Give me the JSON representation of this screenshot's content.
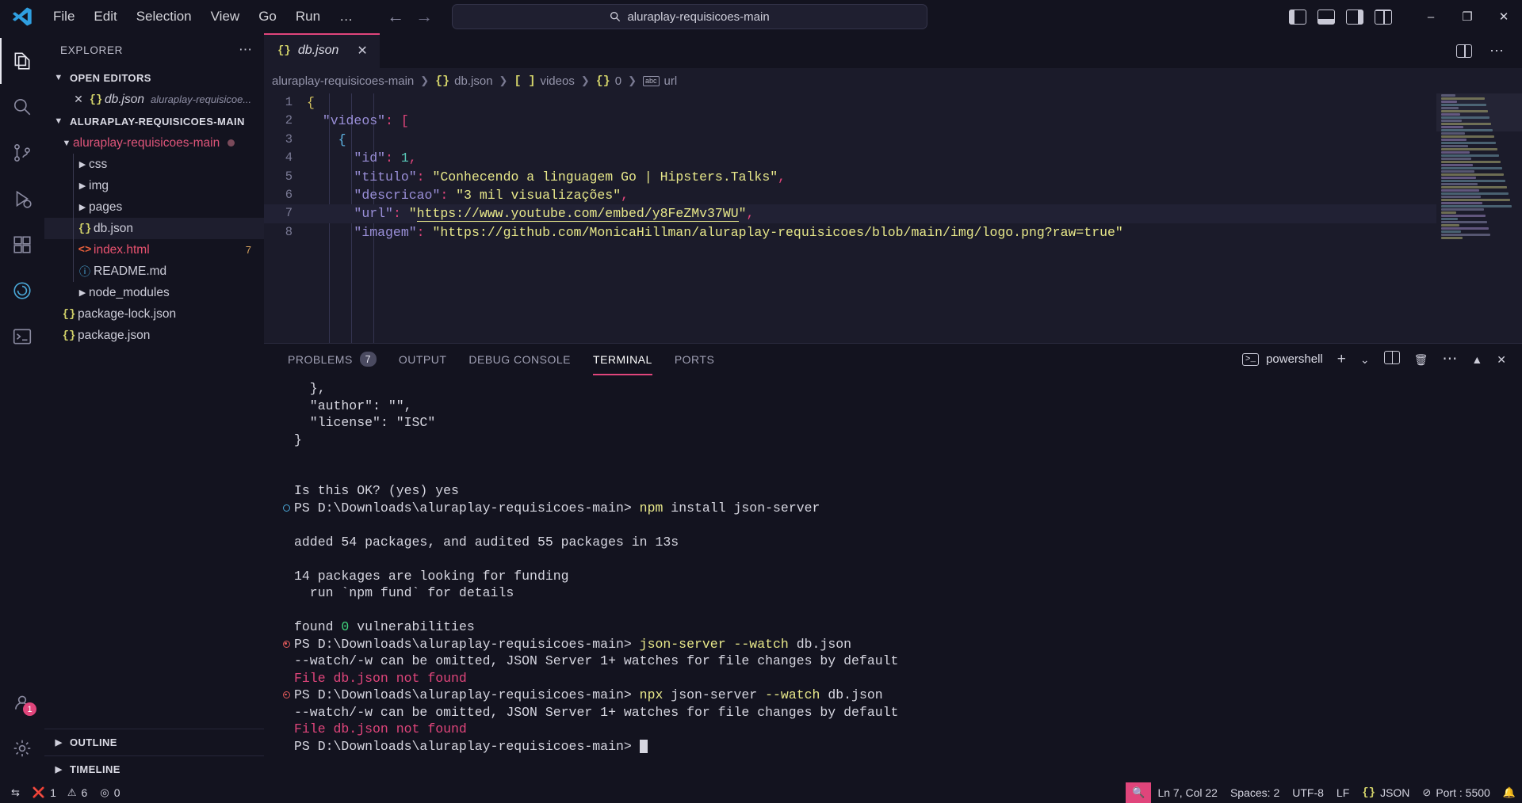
{
  "titlebar": {
    "logo_icon": "vscode-logo-icon",
    "menu": [
      "File",
      "Edit",
      "Selection",
      "View",
      "Go",
      "Run",
      "…"
    ],
    "back_icon": "arrow-left-icon",
    "forward_icon": "arrow-right-icon",
    "search": {
      "value": "aluraplay-requisicoes-main",
      "icon": "search-icon"
    },
    "layout_icons": [
      "toggle-primary-sidebar-icon",
      "toggle-panel-icon",
      "toggle-secondary-sidebar-icon",
      "customize-layout-icon"
    ],
    "window_buttons": {
      "minimize": "–",
      "maximize": "❐",
      "close": "✕"
    }
  },
  "activitybar": {
    "items": [
      {
        "name": "explorer",
        "icon": "files-icon",
        "active": true
      },
      {
        "name": "search",
        "icon": "search-icon",
        "active": false
      },
      {
        "name": "source-control",
        "icon": "source-control-icon",
        "active": false
      },
      {
        "name": "run-and-debug",
        "icon": "debug-icon",
        "active": false
      },
      {
        "name": "extensions",
        "icon": "extensions-icon",
        "active": false
      },
      {
        "name": "live-share",
        "icon": "live-share-icon",
        "active": false
      },
      {
        "name": "terminal-view",
        "icon": "terminal-icon",
        "active": false
      }
    ],
    "accounts": {
      "icon": "account-icon",
      "badge": "1"
    },
    "settings": {
      "icon": "gear-icon"
    }
  },
  "sidebar": {
    "title": "EXPLORER",
    "more_icon": "more-actions-icon",
    "open_editors": {
      "label": "OPEN EDITORS",
      "items": [
        {
          "close_icon": "close-icon",
          "file_icon": "json-icon",
          "name": "db.json",
          "path": "aluraplay-requisicoe..."
        }
      ]
    },
    "workspace": {
      "label": "ALURAPLAY-REQUISICOES-MAIN",
      "tree": [
        {
          "type": "folder",
          "name": "aluraplay-requisicoes-main",
          "expanded": true,
          "depth": 0,
          "dirty": true
        },
        {
          "type": "folder",
          "name": "css",
          "expanded": false,
          "depth": 1
        },
        {
          "type": "folder",
          "name": "img",
          "expanded": false,
          "depth": 1
        },
        {
          "type": "folder",
          "name": "pages",
          "expanded": false,
          "depth": 1
        },
        {
          "type": "file",
          "name": "db.json",
          "icon": "json-icon",
          "depth": 1,
          "selected": true
        },
        {
          "type": "file",
          "name": "index.html",
          "icon": "html-icon",
          "depth": 1,
          "problems": "7"
        },
        {
          "type": "file",
          "name": "README.md",
          "icon": "markdown-icon",
          "depth": 1
        },
        {
          "type": "folder",
          "name": "node_modules",
          "expanded": false,
          "depth": 1
        },
        {
          "type": "file",
          "name": "package-lock.json",
          "icon": "json-icon",
          "depth": 0
        },
        {
          "type": "file",
          "name": "package.json",
          "icon": "json-icon",
          "depth": 0
        }
      ]
    },
    "outline": "OUTLINE",
    "timeline": "TIMELINE"
  },
  "editor": {
    "tab": {
      "icon": "json-icon",
      "name": "db.json",
      "close_icon": "close-icon"
    },
    "tab_actions": [
      "split-editor-icon",
      "more-actions-icon"
    ],
    "breadcrumb": [
      {
        "text": "aluraplay-requisicoes-main",
        "icon": ""
      },
      {
        "text": "db.json",
        "icon": "json-icon"
      },
      {
        "text": "videos",
        "icon": "array-icon"
      },
      {
        "text": "0",
        "icon": "object-icon"
      },
      {
        "text": "url",
        "icon": "string-icon"
      }
    ],
    "lines": [
      {
        "n": "1",
        "segs": [
          {
            "t": "{",
            "c": "t-brace1"
          }
        ]
      },
      {
        "n": "2",
        "segs": [
          {
            "t": "  ",
            "c": "t-punc"
          },
          {
            "t": "\"videos\"",
            "c": "t-key"
          },
          {
            "t": ":",
            "c": "t-colon"
          },
          {
            "t": " ",
            "c": "t-punc"
          },
          {
            "t": "[",
            "c": "t-brace3"
          }
        ]
      },
      {
        "n": "3",
        "segs": [
          {
            "t": "    ",
            "c": "t-punc"
          },
          {
            "t": "{",
            "c": "t-brace2"
          }
        ]
      },
      {
        "n": "4",
        "segs": [
          {
            "t": "      ",
            "c": "t-punc"
          },
          {
            "t": "\"id\"",
            "c": "t-key"
          },
          {
            "t": ":",
            "c": "t-colon"
          },
          {
            "t": " ",
            "c": "t-punc"
          },
          {
            "t": "1",
            "c": "t-num"
          },
          {
            "t": ",",
            "c": "t-colon"
          }
        ]
      },
      {
        "n": "5",
        "segs": [
          {
            "t": "      ",
            "c": "t-punc"
          },
          {
            "t": "\"titulo\"",
            "c": "t-key"
          },
          {
            "t": ":",
            "c": "t-colon"
          },
          {
            "t": " ",
            "c": "t-punc"
          },
          {
            "t": "\"Conhecendo a linguagem Go | Hipsters.Talks\"",
            "c": "t-str"
          },
          {
            "t": ",",
            "c": "t-colon"
          }
        ]
      },
      {
        "n": "6",
        "segs": [
          {
            "t": "      ",
            "c": "t-punc"
          },
          {
            "t": "\"descricao\"",
            "c": "t-key"
          },
          {
            "t": ":",
            "c": "t-colon"
          },
          {
            "t": " ",
            "c": "t-punc"
          },
          {
            "t": "\"3 mil visualizações\"",
            "c": "t-str"
          },
          {
            "t": ",",
            "c": "t-colon"
          }
        ]
      },
      {
        "n": "7",
        "cur": true,
        "segs": [
          {
            "t": "      ",
            "c": "t-punc"
          },
          {
            "t": "\"url\"",
            "c": "t-key"
          },
          {
            "t": ":",
            "c": "t-colon"
          },
          {
            "t": " ",
            "c": "t-punc"
          },
          {
            "t": "\"",
            "c": "t-str"
          },
          {
            "t": "https://www.youtube.com/embed/y8FeZMv37WU",
            "c": "t-link"
          },
          {
            "t": "\"",
            "c": "t-str"
          },
          {
            "t": ",",
            "c": "t-colon"
          }
        ]
      },
      {
        "n": "8",
        "segs": [
          {
            "t": "      ",
            "c": "t-punc"
          },
          {
            "t": "\"imagem\"",
            "c": "t-key"
          },
          {
            "t": ":",
            "c": "t-colon"
          },
          {
            "t": " ",
            "c": "t-punc"
          },
          {
            "t": "\"https://github.com/MonicaHillman/aluraplay-requisicoes/blob/main/img/logo.png?raw=true\"",
            "c": "t-str"
          }
        ]
      }
    ]
  },
  "panel": {
    "tabs": [
      {
        "label": "PROBLEMS",
        "badge": "7",
        "active": false
      },
      {
        "label": "OUTPUT",
        "badge": "",
        "active": false
      },
      {
        "label": "DEBUG CONSOLE",
        "badge": "",
        "active": false
      },
      {
        "label": "TERMINAL",
        "badge": "",
        "active": true
      },
      {
        "label": "PORTS",
        "badge": "",
        "active": false
      }
    ],
    "shell": {
      "label": "powershell",
      "icon": "terminal-icon"
    },
    "actions": [
      "new-terminal-icon",
      "chevron-down-icon",
      "split-terminal-icon",
      "kill-terminal-icon",
      "more-actions-icon",
      "maximize-panel-icon",
      "close-panel-icon"
    ],
    "terminal_lines": [
      {
        "gutter": "",
        "indent": true,
        "segs": [
          {
            "t": "  },",
            "c": "tx"
          }
        ]
      },
      {
        "gutter": "",
        "indent": true,
        "segs": [
          {
            "t": "  \"author\": \"\",",
            "c": "tx"
          }
        ]
      },
      {
        "gutter": "",
        "indent": true,
        "segs": [
          {
            "t": "  \"license\": \"ISC\"",
            "c": "tx"
          }
        ]
      },
      {
        "gutter": "",
        "indent": true,
        "segs": [
          {
            "t": "}",
            "c": "tx"
          }
        ]
      },
      {
        "gutter": "",
        "indent": true,
        "segs": [
          {
            "t": "",
            "c": "tx"
          }
        ]
      },
      {
        "gutter": "",
        "indent": true,
        "segs": [
          {
            "t": "",
            "c": "tx"
          }
        ]
      },
      {
        "gutter": "",
        "indent": true,
        "segs": [
          {
            "t": "Is this OK? (yes) yes",
            "c": "tx"
          }
        ]
      },
      {
        "gutter": "ok",
        "indent": false,
        "segs": [
          {
            "t": "PS D:\\Downloads\\aluraplay-requisicoes-main> ",
            "c": "tx"
          },
          {
            "t": "npm",
            "c": "tx-cmd"
          },
          {
            "t": " install json-server",
            "c": "tx"
          }
        ]
      },
      {
        "gutter": "",
        "indent": true,
        "segs": [
          {
            "t": "",
            "c": "tx"
          }
        ]
      },
      {
        "gutter": "",
        "indent": true,
        "segs": [
          {
            "t": "added 54 packages, and audited 55 packages in 13s",
            "c": "tx"
          }
        ]
      },
      {
        "gutter": "",
        "indent": true,
        "segs": [
          {
            "t": "",
            "c": "tx"
          }
        ]
      },
      {
        "gutter": "",
        "indent": true,
        "segs": [
          {
            "t": "14 packages are looking for funding",
            "c": "tx"
          }
        ]
      },
      {
        "gutter": "",
        "indent": true,
        "segs": [
          {
            "t": "  run `npm fund` for details",
            "c": "tx"
          }
        ]
      },
      {
        "gutter": "",
        "indent": true,
        "segs": [
          {
            "t": "",
            "c": "tx"
          }
        ]
      },
      {
        "gutter": "",
        "indent": true,
        "segs": [
          {
            "t": "found ",
            "c": "tx"
          },
          {
            "t": "0",
            "c": "tx-green"
          },
          {
            "t": " vulnerabilities",
            "c": "tx"
          }
        ]
      },
      {
        "gutter": "err",
        "indent": false,
        "segs": [
          {
            "t": "PS D:\\Downloads\\aluraplay-requisicoes-main> ",
            "c": "tx"
          },
          {
            "t": "json-server",
            "c": "tx-cmd"
          },
          {
            "t": " --watch",
            "c": "tx-warn"
          },
          {
            "t": " db.json",
            "c": "tx"
          }
        ]
      },
      {
        "gutter": "",
        "indent": false,
        "segs": [
          {
            "t": "--watch/-w can be omitted, JSON Server 1+ watches for file changes by default",
            "c": "tx"
          }
        ]
      },
      {
        "gutter": "",
        "indent": false,
        "segs": [
          {
            "t": "File db.json not found",
            "c": "tx-err"
          }
        ]
      },
      {
        "gutter": "err",
        "indent": false,
        "segs": [
          {
            "t": "PS D:\\Downloads\\aluraplay-requisicoes-main> ",
            "c": "tx"
          },
          {
            "t": "npx",
            "c": "tx-cmd"
          },
          {
            "t": " json-server ",
            "c": "tx"
          },
          {
            "t": "--watch",
            "c": "tx-warn"
          },
          {
            "t": " db.json",
            "c": "tx"
          }
        ]
      },
      {
        "gutter": "",
        "indent": false,
        "segs": [
          {
            "t": "--watch/-w can be omitted, JSON Server 1+ watches for file changes by default",
            "c": "tx"
          }
        ]
      },
      {
        "gutter": "",
        "indent": false,
        "segs": [
          {
            "t": "File db.json not found",
            "c": "tx-err"
          }
        ]
      },
      {
        "gutter": "",
        "indent": false,
        "cursor": true,
        "segs": [
          {
            "t": "PS D:\\Downloads\\aluraplay-requisicoes-main> ",
            "c": "tx"
          }
        ]
      }
    ]
  },
  "statusbar": {
    "remote_icon": "remote-window-icon",
    "errors": "1",
    "warnings": "6",
    "ports_forwarded": "0",
    "error_icon": "error-icon",
    "warning_icon": "warning-icon",
    "ports_icon": "radio-tower-icon",
    "search_icon": "search-icon",
    "position": "Ln 7, Col 22",
    "spaces": "Spaces: 2",
    "encoding": "UTF-8",
    "eol": "LF",
    "language": "JSON",
    "language_icon": "json-icon",
    "port": "Port : 5500",
    "port_icon": "circle-slash-icon",
    "bell_icon": "bell-icon"
  },
  "colors": {
    "accent_pink": "#e0457b",
    "bg_dark": "#13131f",
    "bg_editor": "#1b1b2a",
    "string_yellow": "#e8e88a",
    "key_purple": "#9a8fd8"
  }
}
